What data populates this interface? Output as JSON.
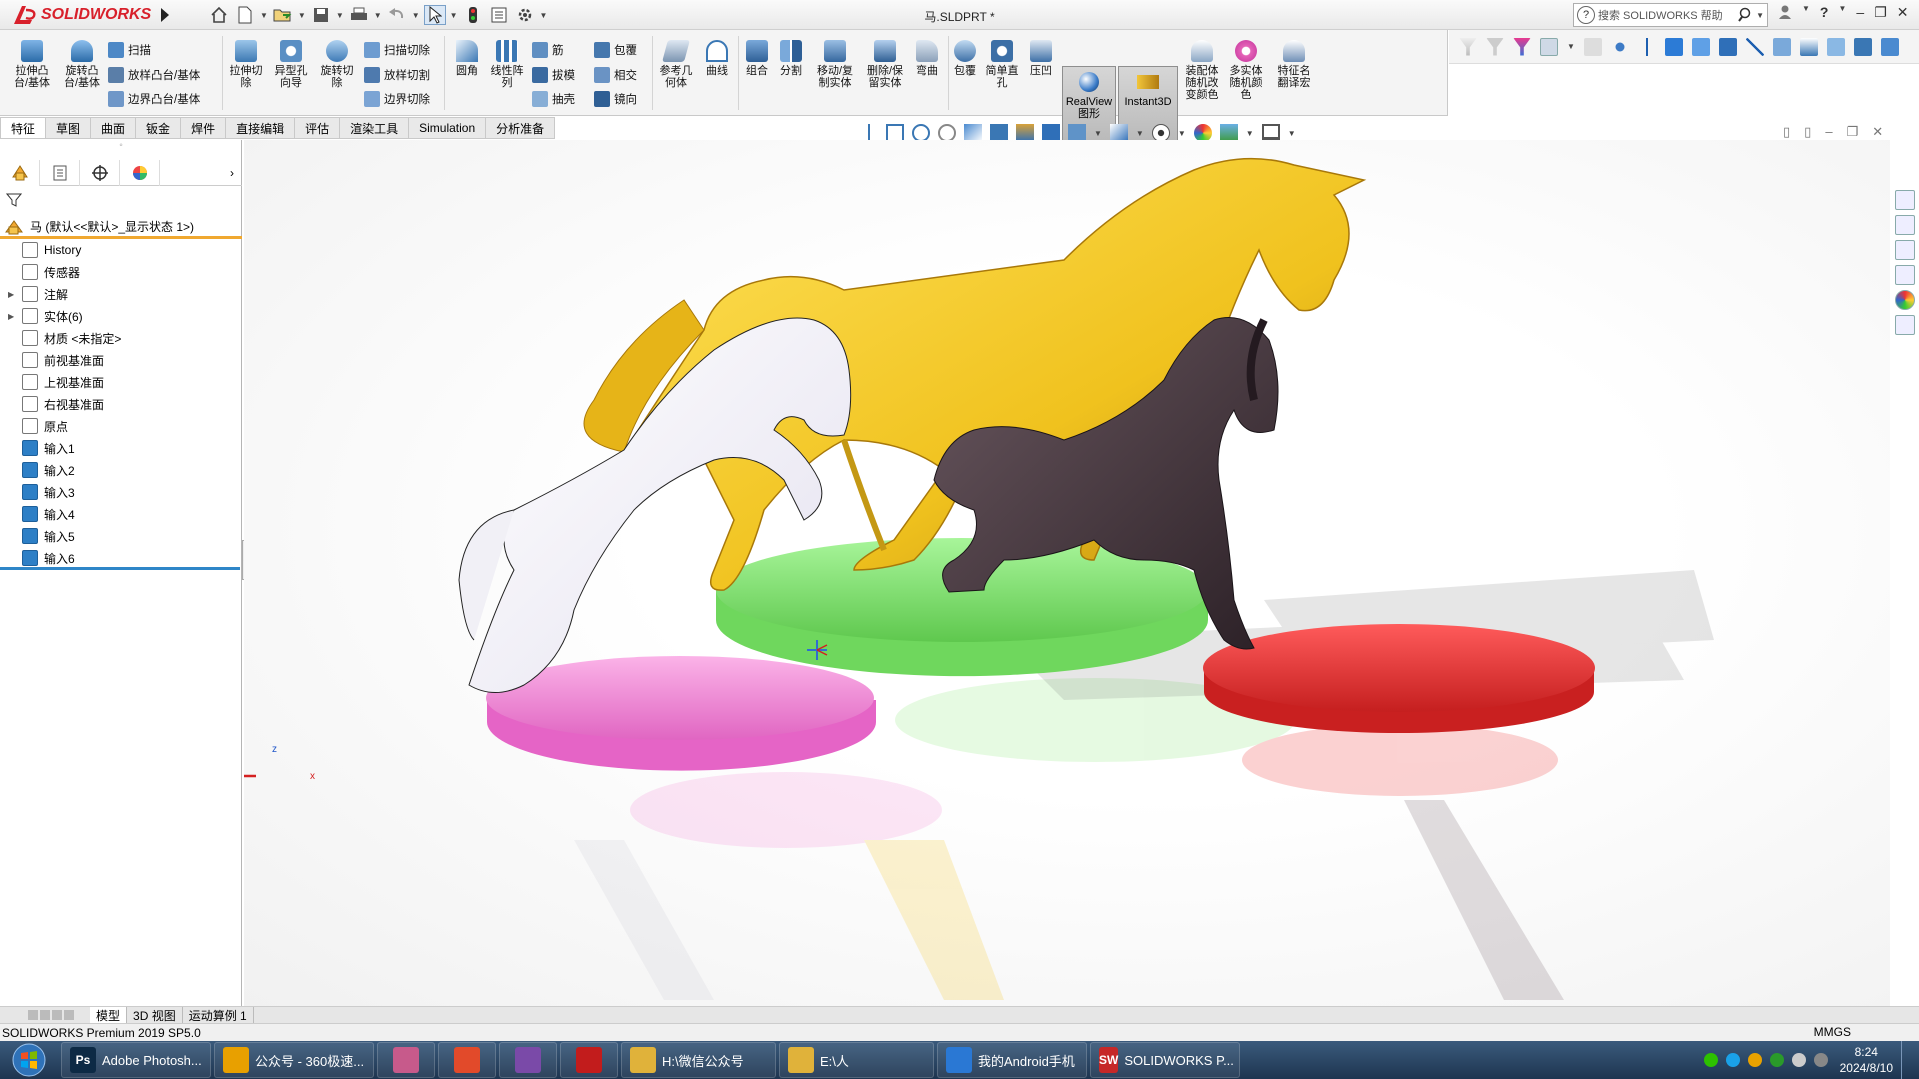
{
  "app": {
    "brand": "SOLIDWORKS",
    "document_title": "马.SLDPRT *",
    "search_placeholder": "搜索 SOLIDWORKS 帮助",
    "help_symbol": "?"
  },
  "window_controls": {
    "minimize": "–",
    "restore": "❐",
    "close": "✕"
  },
  "ribbon": {
    "extrude_boss": "拉伸凸\n台/基体",
    "revolve_boss": "旋转凸\n台/基体",
    "sweep": "扫描",
    "loft_boss": "放样凸台/基体",
    "boundary_boss": "边界凸台/基体",
    "extrude_cut": "拉伸切\n除",
    "hole_wizard": "异型孔\n向导",
    "revolve_cut": "旋转切\n除",
    "swept_cut": "扫描切除",
    "lofted_cut": "放样切割",
    "boundary_cut": "边界切除",
    "fillet": "圆角",
    "linear_pattern": "线性阵\n列",
    "rib": "筋",
    "draft": "拔模",
    "shell": "抽壳",
    "wrap": "包覆",
    "intersect": "相交",
    "mirror": "镜向",
    "ref_geometry": "参考几\n何体",
    "curves": "曲线",
    "combine": "组合",
    "split": "分割",
    "move_copy": "移动/复\n制实体",
    "delete_keep": "删除/保\n留实体",
    "flex": "弯曲",
    "wrap2": "包覆",
    "simple_hole": "简单直\n孔",
    "indent": "压凹",
    "realview": "RealView\n图形",
    "instant3d": "Instant3D",
    "random_color_asm": "装配体\n随机改\n变颜色",
    "multibody_color": "多实体\n随机颜\n色",
    "feature_translate": "特征名\n翻译宏"
  },
  "tabs": [
    "特征",
    "草图",
    "曲面",
    "钣金",
    "焊件",
    "直接编辑",
    "评估",
    "渲染工具",
    "Simulation",
    "分析准备"
  ],
  "tree": {
    "root": "马  (默认<<默认>_显示状态 1>)",
    "items": [
      {
        "label": "History",
        "expand": ""
      },
      {
        "label": "传感器",
        "expand": ""
      },
      {
        "label": "注解",
        "expand": "▶"
      },
      {
        "label": "实体(6)",
        "expand": "▶"
      },
      {
        "label": "材质 <未指定>",
        "expand": ""
      },
      {
        "label": "前视基准面",
        "expand": ""
      },
      {
        "label": "上视基准面",
        "expand": ""
      },
      {
        "label": "右视基准面",
        "expand": ""
      },
      {
        "label": "原点",
        "expand": ""
      },
      {
        "label": "输入1",
        "expand": "",
        "body": true
      },
      {
        "label": "输入2",
        "expand": "",
        "body": true
      },
      {
        "label": "输入3",
        "expand": "",
        "body": true
      },
      {
        "label": "输入4",
        "expand": "",
        "body": true
      },
      {
        "label": "输入5",
        "expand": "",
        "body": true
      },
      {
        "label": "输入6",
        "expand": "",
        "body": true
      }
    ]
  },
  "viewport": {
    "triad": {
      "x": "x",
      "z": "z"
    }
  },
  "colors": {
    "horse_gold": "#f4c92a",
    "horse_white": "#f4f4f8",
    "horse_dark": "#4c3a40",
    "base_green": "#8ee87c",
    "base_pink": "#f58fd8",
    "base_red": "#ee3434",
    "accent": "#2f86c8"
  },
  "bottom_tabs": [
    "模型",
    "3D 视图",
    "运动算例 1"
  ],
  "status": {
    "product": "SOLIDWORKS Premium 2019 SP5.0",
    "units": "MMGS"
  },
  "taskbar": {
    "apps": [
      {
        "label": "Adobe Photosh...",
        "icon": "Ps",
        "color": "#0d2a45"
      },
      {
        "label": "公众号 - 360极速...",
        "icon": "360",
        "color": "#e8a000"
      },
      {
        "label": "",
        "icon": "folder",
        "color": "#c75a8b"
      },
      {
        "label": "",
        "icon": "grid",
        "color": "#e24a2a"
      },
      {
        "label": "",
        "icon": "paint",
        "color": "#7a4aa8"
      },
      {
        "label": "",
        "icon": "record",
        "color": "#c21c1c"
      },
      {
        "label": "H:\\微信公众号",
        "icon": "folder",
        "color": "#e0b23a"
      },
      {
        "label": "E:\\人",
        "icon": "folder",
        "color": "#e0b23a"
      },
      {
        "label": "我的Android手机",
        "icon": "phone",
        "color": "#2a78d4"
      },
      {
        "label": "SOLIDWORKS P...",
        "icon": "SW",
        "color": "#c62828"
      }
    ],
    "clock_time": "8:24",
    "clock_date": "2024/8/10"
  }
}
